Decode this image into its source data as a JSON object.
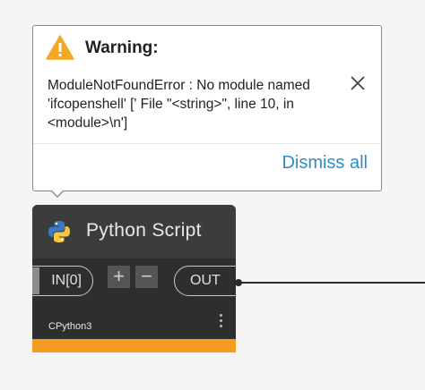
{
  "warning": {
    "title": "Warning:",
    "message": "ModuleNotFoundError : No module named\n'ifcopenshell' ['  File \"<string>\", line 10, in\n<module>\\n']",
    "dismiss_label": "Dismiss all",
    "icon": "warning-triangle-icon",
    "close_icon": "close-icon",
    "colors": {
      "icon": "#f5a623",
      "dismiss": "#2a8ec7"
    }
  },
  "node": {
    "title": "Python Script",
    "icon": "python-icon",
    "input_port": "IN[0]",
    "add_label": "+",
    "remove_label": "−",
    "output_port": "OUT",
    "engine": "CPython3",
    "menu_icon": "more-vertical-icon",
    "colors": {
      "header": "#3c3c3c",
      "body": "#2e2e2e",
      "state_bar": "#f39c1f"
    }
  }
}
